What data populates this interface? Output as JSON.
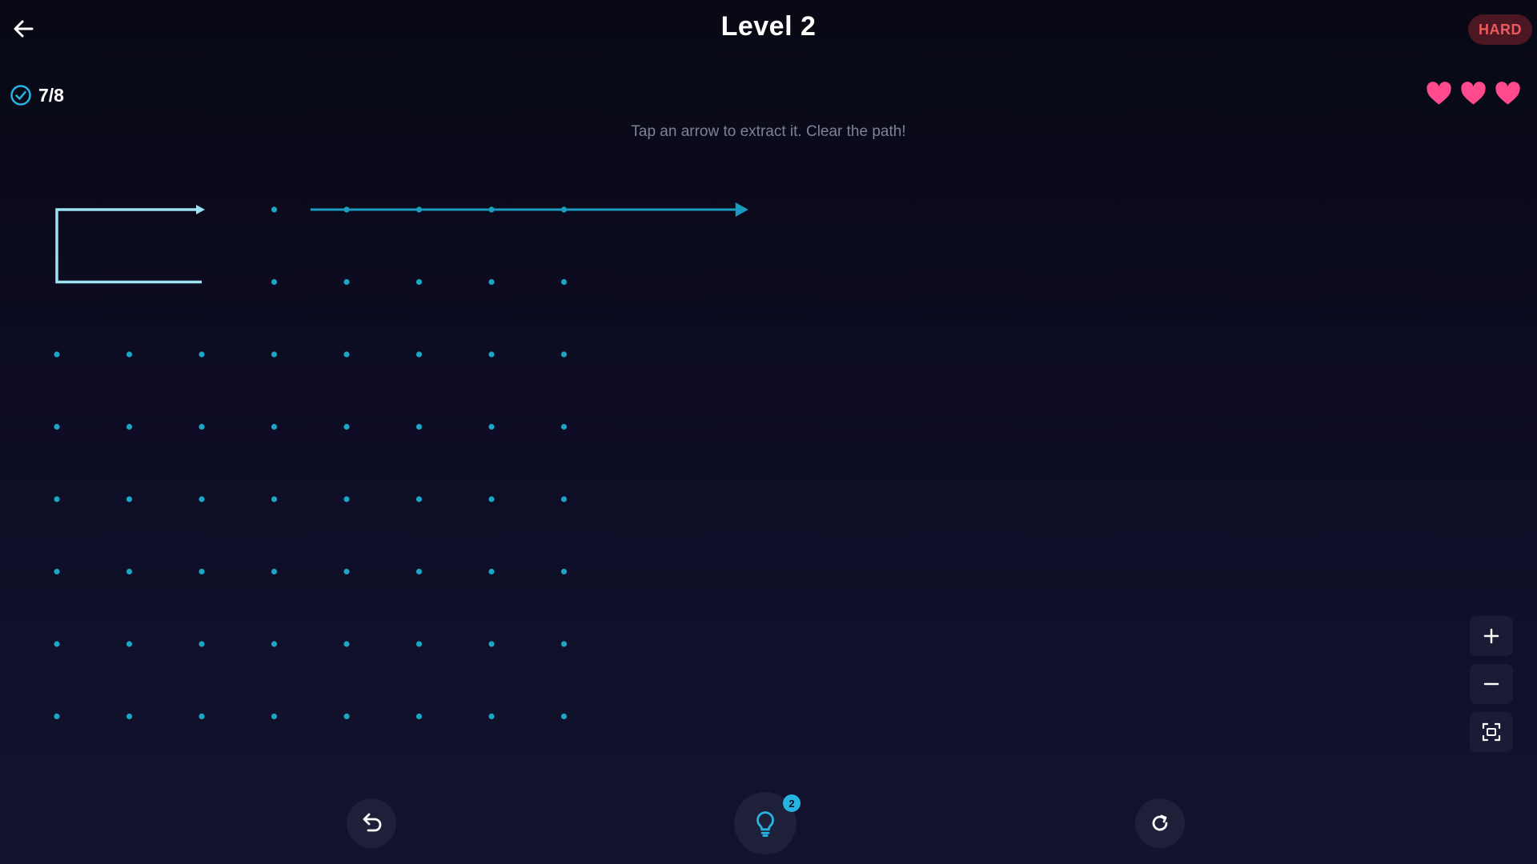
{
  "header": {
    "title": "Level 2",
    "difficulty": "HARD",
    "back_icon": "arrow-left-icon"
  },
  "status": {
    "progress": "7/8",
    "progress_icon": "check-circle-icon",
    "lives": 3,
    "life_icon": "heart-icon",
    "life_color": "#ff4a8d"
  },
  "instruction": "Tap an arrow to extract it. Clear the path!",
  "board": {
    "columns": 8,
    "rows": 8,
    "empty_cells": [
      [
        0,
        0
      ],
      [
        1,
        0
      ],
      [
        2,
        0
      ],
      [
        0,
        1
      ],
      [
        1,
        1
      ],
      [
        2,
        1
      ]
    ],
    "arrows": [
      {
        "id": "arrow-hook",
        "cells": [
          [
            2,
            1
          ],
          [
            0,
            1
          ],
          [
            0,
            0
          ],
          [
            2,
            0
          ]
        ],
        "direction": "right",
        "color": "#9ee3f3"
      },
      {
        "id": "arrow-long",
        "cells": [
          [
            3.5,
            0
          ],
          [
            9.5,
            0
          ]
        ],
        "direction": "right",
        "color": "#1b9bbd"
      }
    ],
    "dot_color": "#1aa6c4"
  },
  "zoom_controls": {
    "zoom_in_icon": "plus-icon",
    "zoom_out_icon": "minus-icon",
    "fit_icon": "fit-screen-icon"
  },
  "bottom_bar": {
    "undo_icon": "undo-icon",
    "hint_icon": "lightbulb-icon",
    "hint_count": "2",
    "restart_icon": "restart-icon"
  },
  "colors": {
    "accent": "#27b4e0",
    "danger": "#ee5a5f",
    "background": "#0d0c24"
  }
}
